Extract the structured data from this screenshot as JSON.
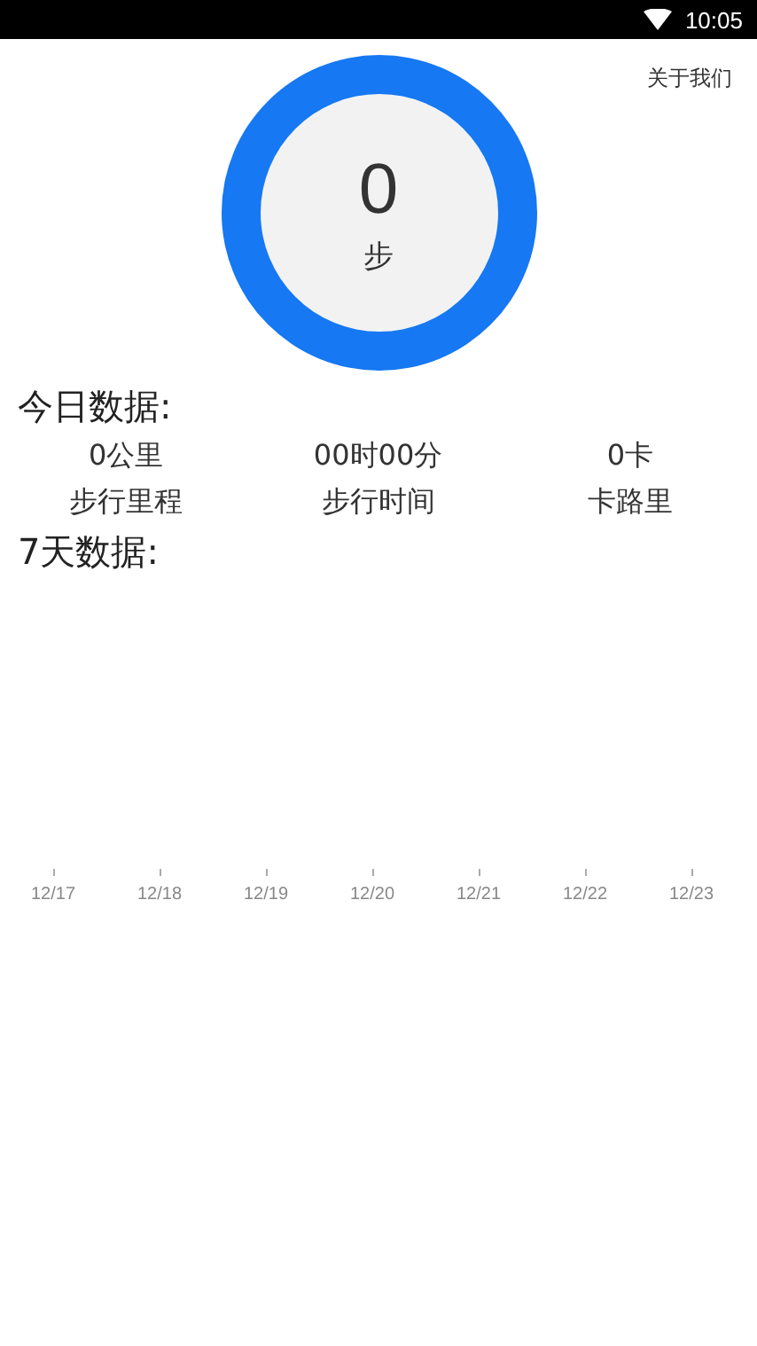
{
  "status_bar": {
    "time": "10:05"
  },
  "about_link": "关于我们",
  "steps": {
    "value": "0",
    "unit": "步"
  },
  "today": {
    "title": "今日数据:",
    "stats": [
      {
        "value": "0公里",
        "label": "步行里程"
      },
      {
        "value": "00时00分",
        "label": "步行时间"
      },
      {
        "value": "0卡",
        "label": "卡路里"
      }
    ]
  },
  "week": {
    "title": "7天数据:",
    "dates": [
      "12/17",
      "12/18",
      "12/19",
      "12/20",
      "12/21",
      "12/22",
      "12/23"
    ]
  }
}
